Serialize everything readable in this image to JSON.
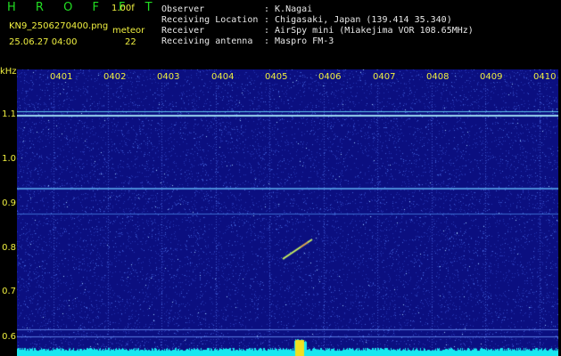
{
  "header": {
    "brand": "H R O F F T",
    "version": "1.00f",
    "filename": "KN9_2506270400.png",
    "timestamp": "25.06.27 04:00",
    "meteor_label": "meteor",
    "meteor_count": "22"
  },
  "info": [
    {
      "label": "Observer",
      "value": ": K.Nagai"
    },
    {
      "label": "Receiving Location",
      "value": ": Chigasaki, Japan (139.414 35.340)"
    },
    {
      "label": "Receiver",
      "value": ": AirSpy mini (Miakejima VOR 108.65MHz)"
    },
    {
      "label": "Receiving antenna",
      "value": ": Maspro FM-3"
    }
  ],
  "axis": {
    "y_unit": "kHz",
    "y_ticks": [
      "1.1",
      "1.0",
      "0.9",
      "0.8",
      "0.7",
      "0.6"
    ],
    "x_ticks": [
      "0401",
      "0402",
      "0403",
      "0404",
      "0405",
      "0406",
      "0407",
      "0408",
      "0409",
      "0410"
    ]
  },
  "colors": {
    "background": "#0b0f80",
    "noise": "#3a55d0",
    "line": "#60c8e8",
    "accent_yellow": "#f0f040",
    "brand_green": "#22dd22"
  }
}
